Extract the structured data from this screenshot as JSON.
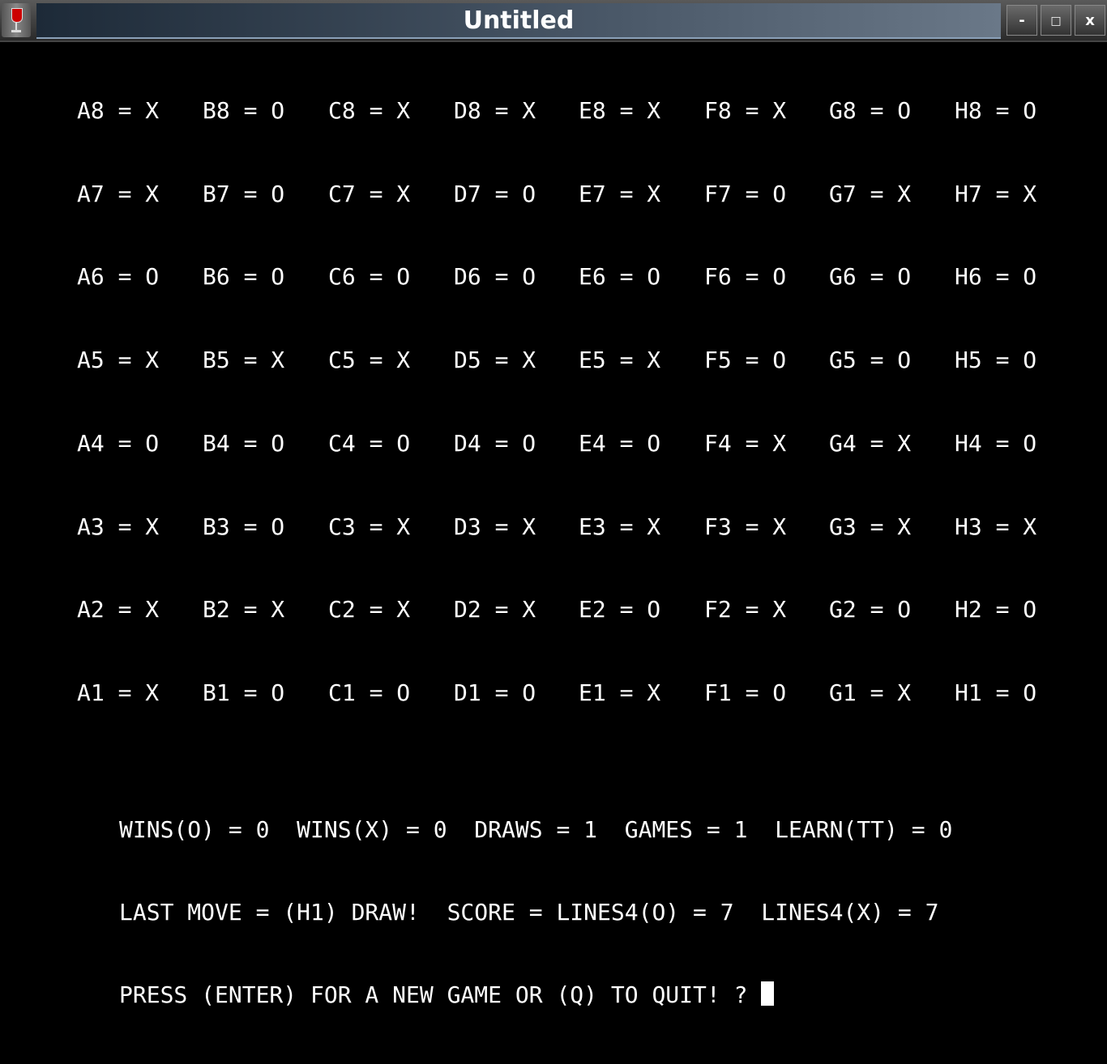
{
  "window": {
    "title": "Untitled",
    "icon": "wine-glass-icon",
    "minimize_label": "-",
    "maximize_label": "□",
    "close_label": "x"
  },
  "board": {
    "columns": [
      "A",
      "B",
      "C",
      "D",
      "E",
      "F",
      "G",
      "H"
    ],
    "rows": [
      {
        "rank": "8",
        "values": [
          "X",
          "O",
          "X",
          "X",
          "X",
          "X",
          "O",
          "O"
        ]
      },
      {
        "rank": "7",
        "values": [
          "X",
          "O",
          "X",
          "O",
          "X",
          "O",
          "X",
          "X"
        ]
      },
      {
        "rank": "6",
        "values": [
          "O",
          "O",
          "O",
          "O",
          "O",
          "O",
          "O",
          "O"
        ]
      },
      {
        "rank": "5",
        "values": [
          "X",
          "X",
          "X",
          "X",
          "X",
          "O",
          "O",
          "O"
        ]
      },
      {
        "rank": "4",
        "values": [
          "O",
          "O",
          "O",
          "O",
          "O",
          "X",
          "X",
          "O"
        ]
      },
      {
        "rank": "3",
        "values": [
          "X",
          "O",
          "X",
          "X",
          "X",
          "X",
          "X",
          "X"
        ]
      },
      {
        "rank": "2",
        "values": [
          "X",
          "X",
          "X",
          "X",
          "O",
          "X",
          "O",
          "O"
        ]
      },
      {
        "rank": "1",
        "values": [
          "X",
          "O",
          "O",
          "O",
          "X",
          "O",
          "X",
          "O"
        ]
      }
    ]
  },
  "status": {
    "line1": "WINS(O) = 0  WINS(X) = 0  DRAWS = 1  GAMES = 1  LEARN(TT) = 0",
    "line2": "LAST MOVE = (H1) DRAW!  SCORE = LINES4(O) = 7  LINES4(X) = 7",
    "prompt": "PRESS (ENTER) FOR A NEW GAME OR (Q) TO QUIT! ? "
  }
}
